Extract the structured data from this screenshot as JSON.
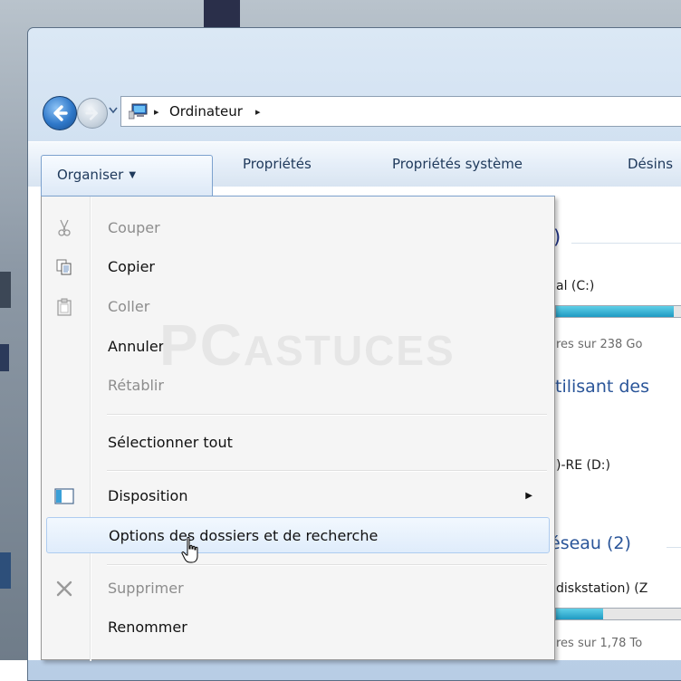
{
  "address_bar": {
    "breadcrumb": "Ordinateur",
    "separator": "▸"
  },
  "command_bar": {
    "organiser": "Organiser",
    "proprietes": "Propriétés",
    "proprietes_systeme": "Propriétés système",
    "desinstaller_partial": "Désins"
  },
  "content": {
    "drive_c_label": "al (C:)",
    "drive_c_free": "res sur 238 Go",
    "drive_c_usage_fraction": 0.82,
    "group_removable": "tilisant des",
    "drive_d_label": ")-RE (D:)",
    "group_network": "éseau (2)",
    "network_drive_label": "diskstation) (Z",
    "network_drive_free": "res sur 1,78 To",
    "network_drive_usage_fraction": 0.33,
    "group_partial_count": ")"
  },
  "watermark": {
    "big": "PC",
    "rest": "ASTUCES"
  },
  "menu": {
    "items": [
      {
        "label": "Couper",
        "icon": "scissors-icon",
        "disabled": true
      },
      {
        "label": "Copier",
        "icon": "copy-icon",
        "disabled": false
      },
      {
        "label": "Coller",
        "icon": "paste-icon",
        "disabled": true
      },
      {
        "label": "Annuler",
        "icon": "",
        "disabled": false
      },
      {
        "label": "Rétablir",
        "icon": "",
        "disabled": true
      },
      {
        "label": "Sélectionner tout",
        "icon": "",
        "disabled": false
      },
      {
        "label": "Disposition",
        "icon": "layout-icon",
        "disabled": false,
        "submenu": true
      },
      {
        "label": "Options des dossiers et de recherche",
        "icon": "",
        "disabled": false,
        "highlighted": true
      },
      {
        "label": "Supprimer",
        "icon": "delete-x-icon",
        "disabled": true
      },
      {
        "label": "Renommer",
        "icon": "",
        "disabled": false
      }
    ],
    "submenu_arrow": "▶"
  },
  "colors": {
    "accent_text": "#1e395b",
    "heading_blue": "#1e3287",
    "disabled_text": "#8d8d8d",
    "highlight_border": "#aeccf0"
  }
}
